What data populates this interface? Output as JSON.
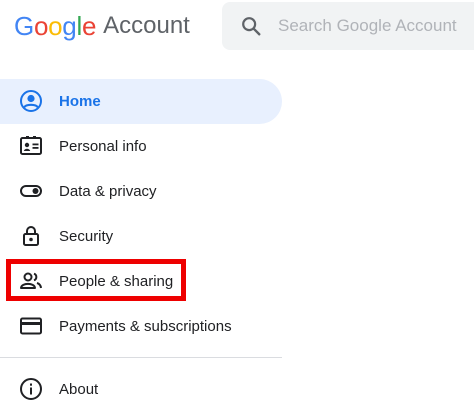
{
  "header": {
    "logo_google": "Google",
    "logo_product": "Account",
    "search_placeholder": "Search Google Account",
    "search_icon": "search-icon"
  },
  "nav": {
    "items": [
      {
        "id": "home",
        "label": "Home",
        "icon": "account-circle-icon",
        "active": true
      },
      {
        "id": "personal-info",
        "label": "Personal info",
        "icon": "id-card-icon",
        "active": false
      },
      {
        "id": "data-privacy",
        "label": "Data & privacy",
        "icon": "toggle-icon",
        "active": false
      },
      {
        "id": "security",
        "label": "Security",
        "icon": "lock-icon",
        "active": false
      },
      {
        "id": "people-sharing",
        "label": "People & sharing",
        "icon": "people-icon",
        "active": false,
        "highlighted": true
      },
      {
        "id": "payments",
        "label": "Payments & subscriptions",
        "icon": "credit-card-icon",
        "active": false
      }
    ],
    "footer_items": [
      {
        "id": "about",
        "label": "About",
        "icon": "info-icon"
      }
    ]
  },
  "colors": {
    "google_blue": "#4285F4",
    "google_red": "#EA4335",
    "google_yellow": "#FBBC05",
    "google_green": "#34A853",
    "active_text": "#1a73e8",
    "active_bg": "#e8f0fe",
    "highlight_box": "#ee0000"
  }
}
